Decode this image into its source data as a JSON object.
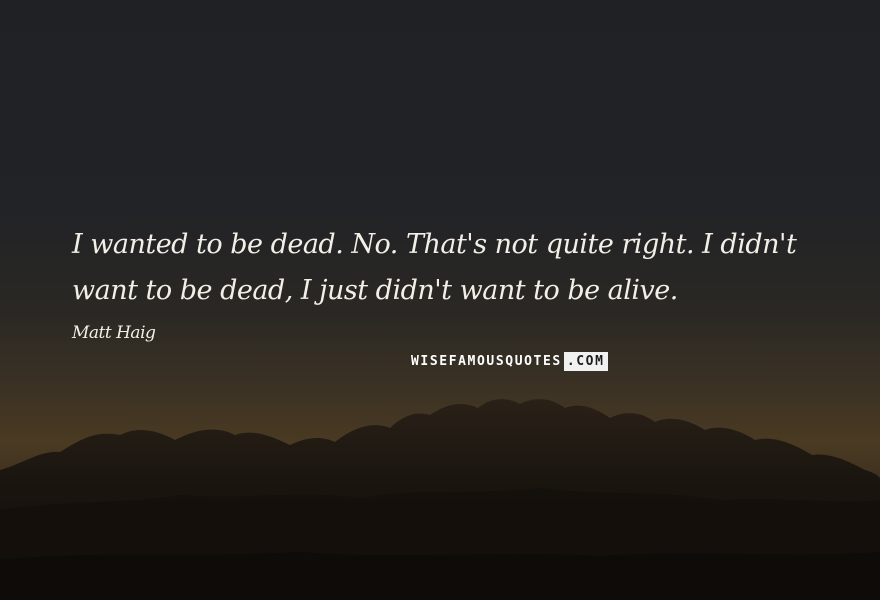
{
  "quote": {
    "text": "I wanted to be dead. No. That's not quite right. I didn't want to be dead, I just didn't want to be alive."
  },
  "author": {
    "name": "Matt Haig"
  },
  "watermark": {
    "part1": "WISEFAMOUSQUOTES",
    "part2": ".COM"
  },
  "colors": {
    "text": "#f2efe6",
    "sky_top": "#1f2125",
    "horizon_glow": "#4a3a22",
    "cloud_silhouette": "#16120e"
  }
}
